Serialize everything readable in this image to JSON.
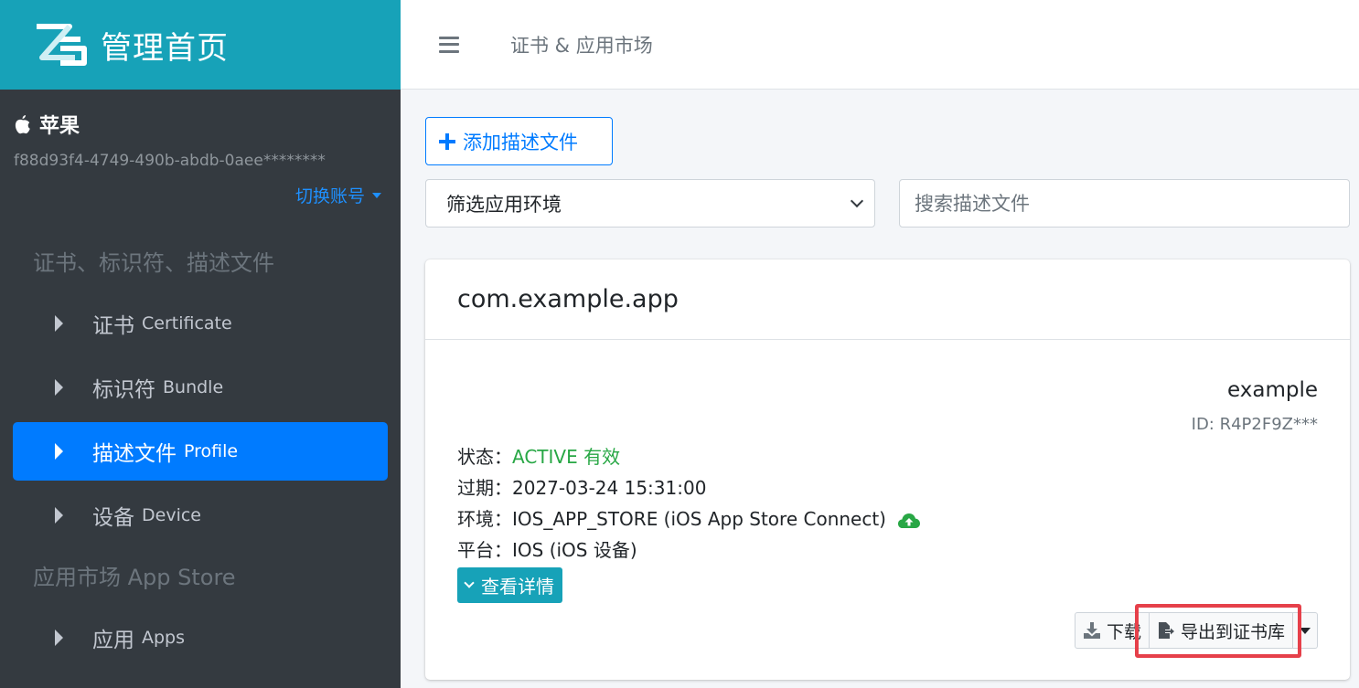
{
  "brand": {
    "title": "管理首页",
    "logo_icon": "zg-logo-icon"
  },
  "account": {
    "name": "苹果",
    "id": "f88d93f4-4749-490b-abdb-0aee********",
    "switch_label": "切换账号"
  },
  "sidebar": {
    "section1": "证书、标识符、描述文件",
    "items1": [
      {
        "zh": "证书",
        "en": "Certificate",
        "active": false
      },
      {
        "zh": "标识符",
        "en": "Bundle",
        "active": false
      },
      {
        "zh": "描述文件",
        "en": "Profile",
        "active": true
      },
      {
        "zh": "设备",
        "en": "Device",
        "active": false
      }
    ],
    "section2": "应用市场 App Store",
    "items2": [
      {
        "zh": "应用",
        "en": "Apps",
        "active": false
      }
    ]
  },
  "topbar": {
    "title": "证书 & 应用市场"
  },
  "toolbar": {
    "add_label": "添加描述文件",
    "filter_value": "筛选应用环境",
    "search_placeholder": "搜索描述文件"
  },
  "card": {
    "bundle": "com.example.app",
    "name": "example",
    "id_text": "ID: R4P2F9Z***",
    "status_label": "状态：",
    "status_value": "ACTIVE 有效",
    "expire_label": "过期：",
    "expire_value": "2027-03-24 15:31:00",
    "env_label": "环境：",
    "env_value": "IOS_APP_STORE (iOS App Store Connect)",
    "platform_label": "平台：",
    "platform_value": "IOS (iOS 设备)",
    "detail_label": "查看详情",
    "download_label": "下载",
    "export_label": "导出到证书库"
  },
  "colors": {
    "brand": "#17a2b8",
    "sidebar": "#343a40",
    "active": "#007bff",
    "status": "#28a745",
    "highlight": "#e6404a"
  }
}
